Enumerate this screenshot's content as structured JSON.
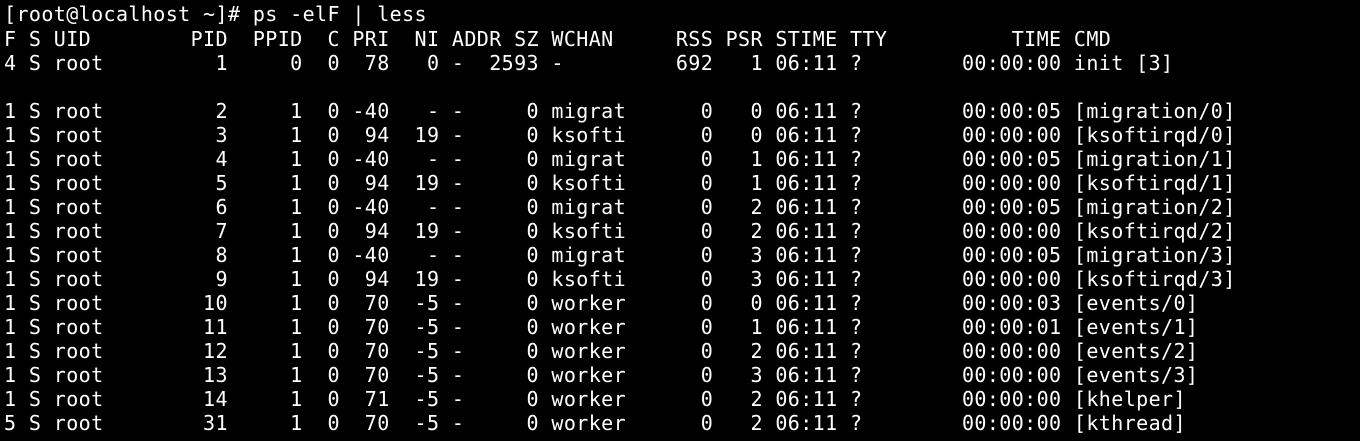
{
  "terminal": {
    "prompt_command": "[root@localhost ~]# ps -elF | less",
    "header": "F S UID        PID  PPID  C PRI  NI ADDR SZ WCHAN     RSS PSR STIME TTY          TIME CMD",
    "rows": [
      "4 S root         1     0  0  78   0 -  2593 -         692   1 06:11 ?        00:00:00 init [3]",
      "",
      "1 S root         2     1  0 -40   - -     0 migrat      0   0 06:11 ?        00:00:05 [migration/0]",
      "1 S root         3     1  0  94  19 -     0 ksofti      0   0 06:11 ?        00:00:00 [ksoftirqd/0]",
      "1 S root         4     1  0 -40   - -     0 migrat      0   1 06:11 ?        00:00:05 [migration/1]",
      "1 S root         5     1  0  94  19 -     0 ksofti      0   1 06:11 ?        00:00:00 [ksoftirqd/1]",
      "1 S root         6     1  0 -40   - -     0 migrat      0   2 06:11 ?        00:00:05 [migration/2]",
      "1 S root         7     1  0  94  19 -     0 ksofti      0   2 06:11 ?        00:00:00 [ksoftirqd/2]",
      "1 S root         8     1  0 -40   - -     0 migrat      0   3 06:11 ?        00:00:05 [migration/3]",
      "1 S root         9     1  0  94  19 -     0 ksofti      0   3 06:11 ?        00:00:00 [ksoftirqd/3]",
      "1 S root        10     1  0  70  -5 -     0 worker      0   0 06:11 ?        00:00:03 [events/0]",
      "1 S root        11     1  0  70  -5 -     0 worker      0   1 06:11 ?        00:00:01 [events/1]",
      "1 S root        12     1  0  70  -5 -     0 worker      0   2 06:11 ?        00:00:00 [events/2]",
      "1 S root        13     1  0  70  -5 -     0 worker      0   3 06:11 ?        00:00:00 [events/3]",
      "1 S root        14     1  0  71  -5 -     0 worker      0   2 06:11 ?        00:00:00 [khelper]",
      "5 S root        31     1  0  70  -5 -     0 worker      0   2 06:11 ?        00:00:00 [kthread]"
    ]
  }
}
